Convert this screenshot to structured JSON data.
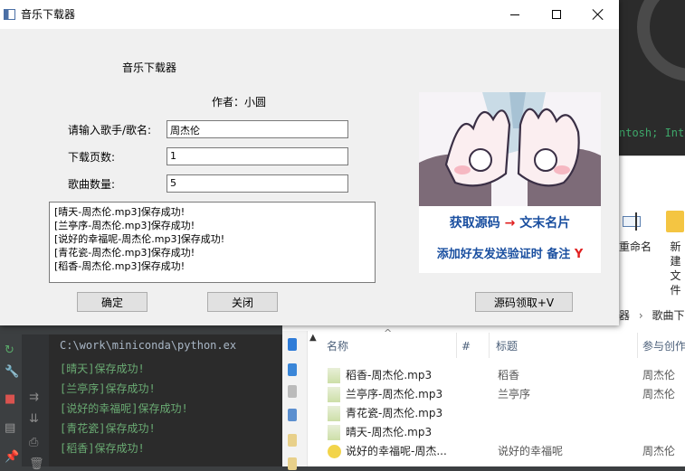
{
  "window": {
    "title": "音乐下载器"
  },
  "form": {
    "header": "音乐下载器",
    "author": "作者：小圆",
    "singer_label": "请输入歌手/歌名:",
    "singer_value": "周杰伦",
    "pages_label": "下载页数:",
    "pages_value": "1",
    "count_label": "歌曲数量:",
    "count_value": "5"
  },
  "log": [
    "[晴天-周杰伦.mp3]保存成功!",
    "[兰亭序-周杰伦.mp3]保存成功!",
    "[说好的幸福呢-周杰伦.mp3]保存成功!",
    "[青花瓷-周杰伦.mp3]保存成功!",
    "[稻香-周杰伦.mp3]保存成功!"
  ],
  "buttons": {
    "ok": "确定",
    "close": "关闭",
    "source": "源码领取+V"
  },
  "promo": {
    "line1_a": "获取源码",
    "arrow": "→",
    "line1_b": "文末名片",
    "line2_a": "添加好友发送验证时 备注",
    "line2_b": "Y"
  },
  "ide": {
    "path": "C:\\work\\miniconda\\python.ex",
    "lines": [
      "[晴天]保存成功!",
      "[兰亭序]保存成功!",
      "[说好的幸福呢]保存成功!",
      "[青花瓷]保存成功!",
      "[稻香]保存成功!"
    ]
  },
  "background_top": {
    "code": "ntosh; Int"
  },
  "explorer": {
    "ribbon": {
      "rename": "重命名",
      "new_a": "新建",
      "new_b": "文件"
    },
    "address": [
      "器",
      "›",
      "歌曲下"
    ],
    "columns": {
      "name": "名称",
      "num": "#",
      "title": "标题",
      "artist": "参与创作"
    },
    "files": [
      {
        "name": "稻香-周杰伦.mp3",
        "title": "稻香",
        "artist": "周杰伦"
      },
      {
        "name": "兰亭序-周杰伦.mp3",
        "title": "兰亭序",
        "artist": "周杰伦"
      },
      {
        "name": "青花瓷-周杰伦.mp3",
        "title": "",
        "artist": ""
      },
      {
        "name": "晴天-周杰伦.mp3",
        "title": "",
        "artist": ""
      },
      {
        "name": "说好的幸福呢-周杰...",
        "title": "说好的幸福呢",
        "artist": "周杰伦"
      }
    ]
  },
  "colors": {
    "ide_text": "#6aab73",
    "path_text": "#a9b7c6",
    "promo_blue": "#1a4fa0",
    "promo_red": "#e02020"
  },
  "icons": [
    "app-icon",
    "minimize-icon",
    "maximize-icon",
    "close-icon",
    "rerun-icon",
    "wrench-icon",
    "stop-icon",
    "file-icon"
  ]
}
